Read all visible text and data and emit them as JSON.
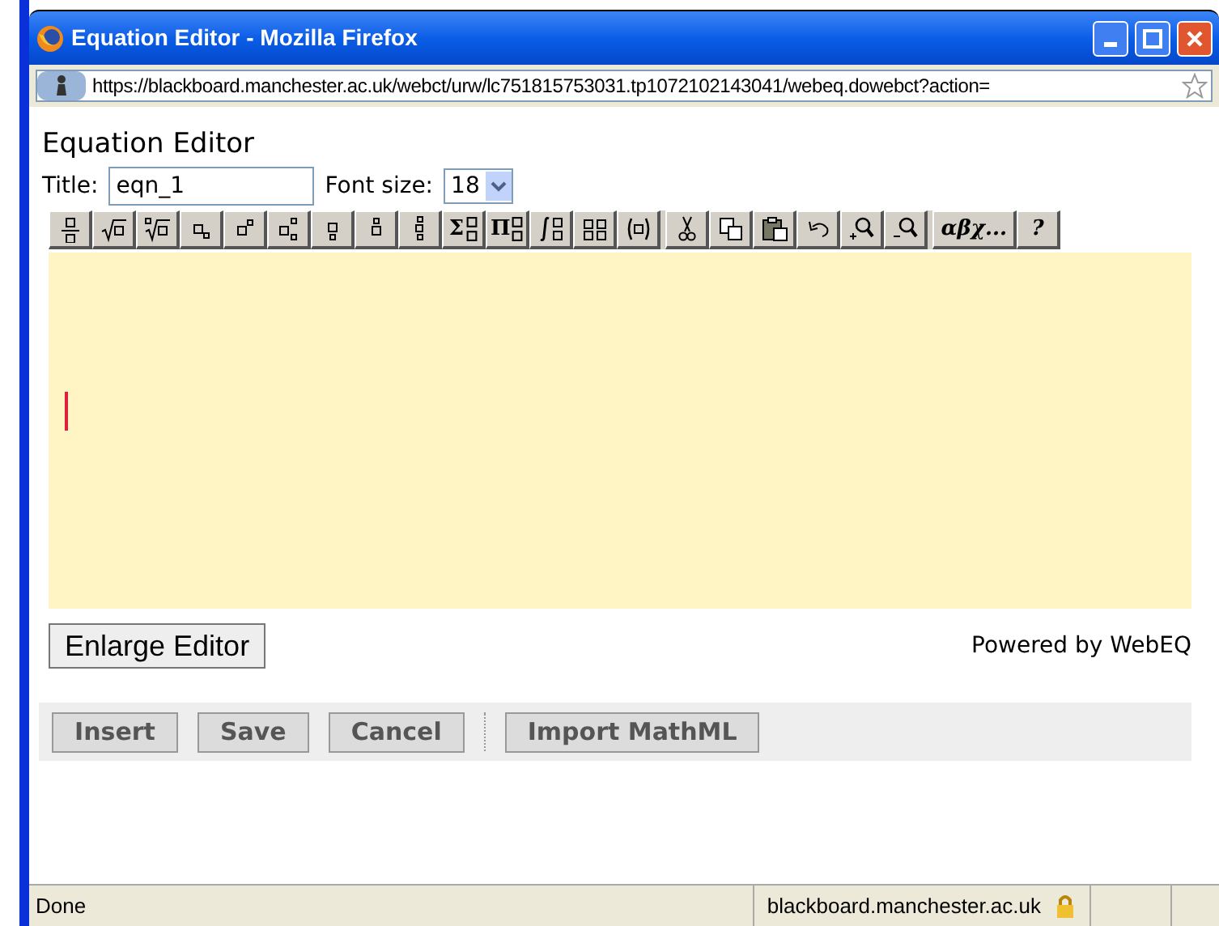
{
  "window": {
    "title": "Equation Editor - Mozilla Firefox"
  },
  "address_bar": {
    "url": "https://blackboard.manchester.ac.uk/webct/urw/lc751815753031.tp1072102143041/webeq.dowebct?action="
  },
  "heading": "Equation Editor",
  "title_field": {
    "label": "Title:",
    "value": "eqn_1"
  },
  "font_size": {
    "label": "Font size:",
    "value": "18"
  },
  "toolbar_groups": [
    {
      "buttons": [
        {
          "kind": "fraction"
        },
        {
          "kind": "sqrt"
        },
        {
          "kind": "root"
        },
        {
          "kind": "sub"
        },
        {
          "kind": "sup"
        },
        {
          "kind": "subsup"
        },
        {
          "kind": "under"
        },
        {
          "kind": "over"
        },
        {
          "kind": "underover"
        },
        {
          "kind": "sum",
          "label": "Σ"
        },
        {
          "kind": "product",
          "label": "Π"
        },
        {
          "kind": "integral"
        },
        {
          "kind": "matrix"
        },
        {
          "kind": "fence"
        }
      ]
    },
    {
      "buttons": [
        {
          "kind": "cut"
        },
        {
          "kind": "copy"
        },
        {
          "kind": "paste"
        },
        {
          "kind": "undo"
        },
        {
          "kind": "zoom-in"
        },
        {
          "kind": "zoom-out"
        }
      ]
    },
    {
      "buttons": [
        {
          "kind": "text",
          "label": "αβχ..."
        },
        {
          "kind": "text",
          "label": "?"
        }
      ]
    }
  ],
  "enlarge_button": "Enlarge Editor",
  "powered_by": "Powered by WebEQ",
  "action_groups": [
    {
      "buttons": [
        "Insert",
        "Save",
        "Cancel"
      ]
    },
    {
      "buttons": [
        "Import MathML"
      ]
    }
  ],
  "status_bar": {
    "text": "Done",
    "host": "blackboard.manchester.ac.uk"
  }
}
